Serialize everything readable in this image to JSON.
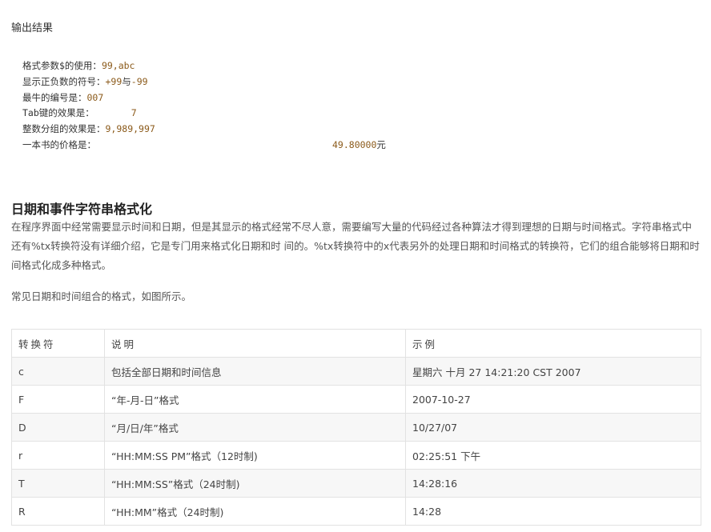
{
  "output_label": "输出结果",
  "code_lines": [
    {
      "label": "格式参数$的使用：",
      "value": "99,abc",
      "suffix": ""
    },
    {
      "label": "显示正负数的符号：",
      "value": "+99",
      "mid": "与",
      "value2": "-99"
    },
    {
      "label": "最牛的编号是：",
      "value": "007",
      "suffix": ""
    },
    {
      "label": "Tab键的效果是：",
      "value": "7",
      "suffix": ""
    },
    {
      "label": "整数分组的效果是：",
      "value": "9,989,997",
      "suffix": ""
    },
    {
      "label": "一本书的价格是：",
      "value": "49.80000",
      "suffix": "元"
    }
  ],
  "section": {
    "heading": "日期和事件字符串格式化",
    "para1": "在程序界面中经常需要显示时间和日期，但是其显示的格式经常不尽人意，需要编写大量的代码经过各种算法才得到理想的日期与时间格式。字符串格式中还有%tx转换符没有详细介绍，它是专门用来格式化日期和时 间的。%tx转换符中的x代表另外的处理日期和时间格式的转换符，它们的组合能够将日期和时间格式化成多种格式。",
    "para2": "常见日期和时间组合的格式，如图所示。"
  },
  "table": {
    "headers": [
      "转换符",
      "说明",
      "示例"
    ],
    "rows": [
      [
        "c",
        "包括全部日期和时间信息",
        "星期六 十月 27 14:21:20 CST 2007"
      ],
      [
        "F",
        "“年-月-日”格式",
        "2007-10-27"
      ],
      [
        "D",
        "“月/日/年”格式",
        "10/27/07"
      ],
      [
        "r",
        "“HH:MM:SS PM”格式（12时制)",
        "02:25:51 下午"
      ],
      [
        "T",
        "“HH:MM:SS”格式（24时制)",
        "14:28:16"
      ],
      [
        "R",
        "“HH:MM”格式（24时制)",
        "14:28"
      ]
    ]
  }
}
